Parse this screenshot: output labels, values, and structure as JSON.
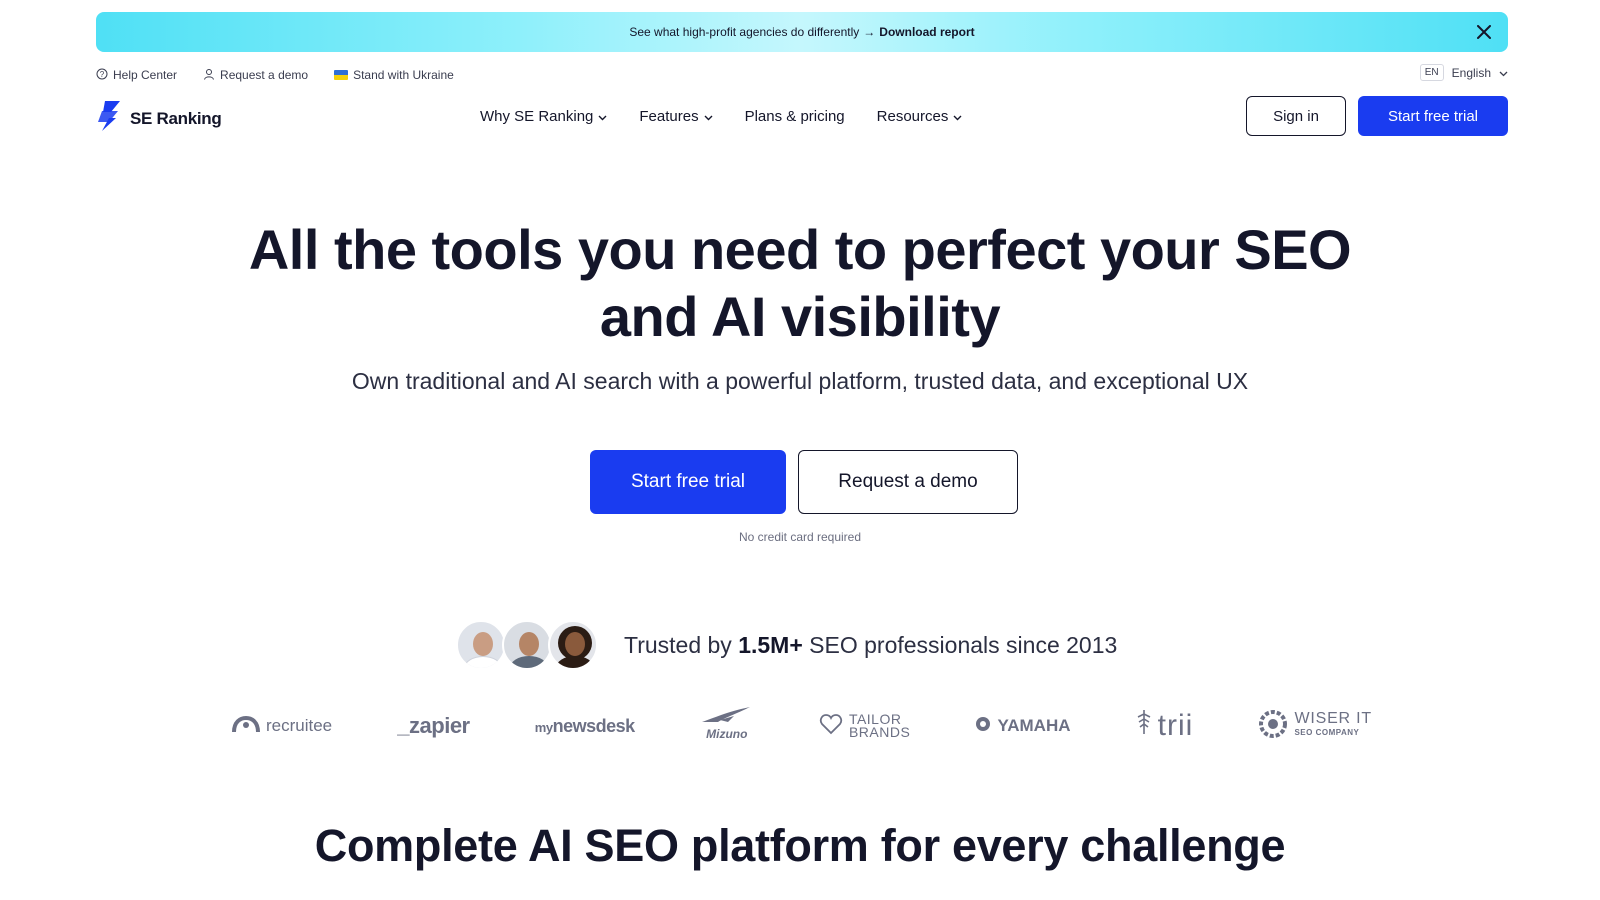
{
  "banner": {
    "text": "See what high-profit agencies do differently",
    "arrow": "→",
    "link": "Download report",
    "close_icon": "close-icon"
  },
  "utility": {
    "help": "Help Center",
    "demo": "Request a demo",
    "ukraine": "Stand with Ukraine",
    "lang_code": "EN",
    "lang_name": "English"
  },
  "nav": {
    "brand": "SE Ranking",
    "items": [
      {
        "label": "Why SE Ranking",
        "has_dropdown": true
      },
      {
        "label": "Features",
        "has_dropdown": true
      },
      {
        "label": "Plans & pricing",
        "has_dropdown": false
      },
      {
        "label": "Resources",
        "has_dropdown": true
      }
    ],
    "sign_in": "Sign in",
    "trial": "Start free trial"
  },
  "hero": {
    "title_line1": "All the tools you need to perfect your SEO",
    "title_line2": "and AI visibility",
    "subtitle": "Own traditional and AI search with a powerful platform, trusted data, and exceptional UX",
    "cta_primary": "Start free trial",
    "cta_secondary": "Request a demo",
    "note": "No credit card required"
  },
  "trusted": {
    "prefix": "Trusted by ",
    "highlight": "1.5M+",
    "suffix": " SEO professionals since 2013"
  },
  "logos": {
    "recruitee": "recruitee",
    "zapier": "_zapier",
    "newsdesk_prefix": "my",
    "newsdesk": "newsdesk",
    "mizuno": "Mizuno",
    "tailor_1": "TAILOR",
    "tailor_2": "BRANDS",
    "yamaha": "YAMAHA",
    "trii": "trii",
    "wiser_1": "WISER IT",
    "wiser_2": "SEO COMPANY"
  },
  "section": {
    "title": "Complete AI SEO platform for every challenge"
  },
  "colors": {
    "primary": "#1a3cf0",
    "text": "#14162a",
    "banner_cyan": "#4fe0f5"
  }
}
